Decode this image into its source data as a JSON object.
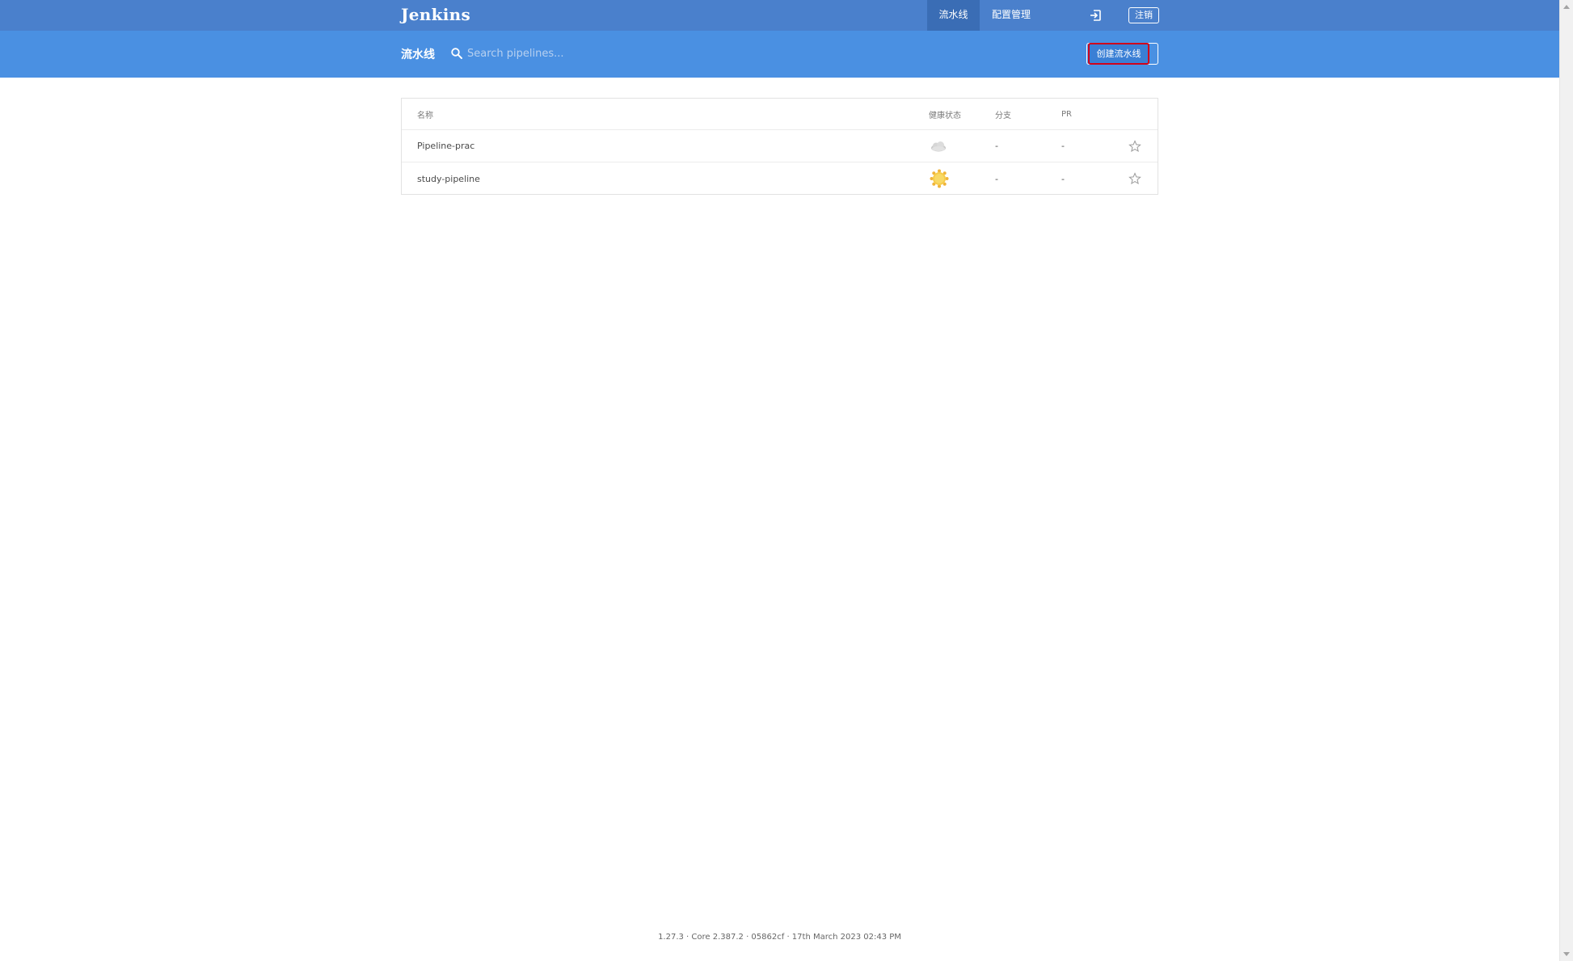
{
  "header": {
    "brand": "Jenkins",
    "nav": [
      {
        "label": "流水线",
        "active": true
      },
      {
        "label": "配置管理",
        "active": false
      }
    ],
    "logout_label": "注销",
    "signin_icon": "sign-in-icon"
  },
  "subheader": {
    "title": "流水线",
    "search_placeholder": "Search pipelines...",
    "search_value": "",
    "create_label": "创建流水线"
  },
  "table": {
    "columns": {
      "name": "名称",
      "health": "健康状态",
      "branch": "分支",
      "pr": "PR"
    },
    "rows": [
      {
        "name": "Pipeline-prac",
        "health_icon": "cloudy-weather-icon",
        "branch": "-",
        "pr": "-",
        "favorite": false
      },
      {
        "name": "study-pipeline",
        "health_icon": "sunny-weather-icon",
        "branch": "-",
        "pr": "-",
        "favorite": false
      }
    ]
  },
  "footer": {
    "version": "1.27.3 · Core 2.387.2 · 05862cf · 17th March 2023 02:43 PM"
  },
  "colors": {
    "topbar": "#4a80cc",
    "topbar_active": "#3a6db5",
    "subbar": "#4a90e2",
    "highlight_border": "#d0021b"
  }
}
